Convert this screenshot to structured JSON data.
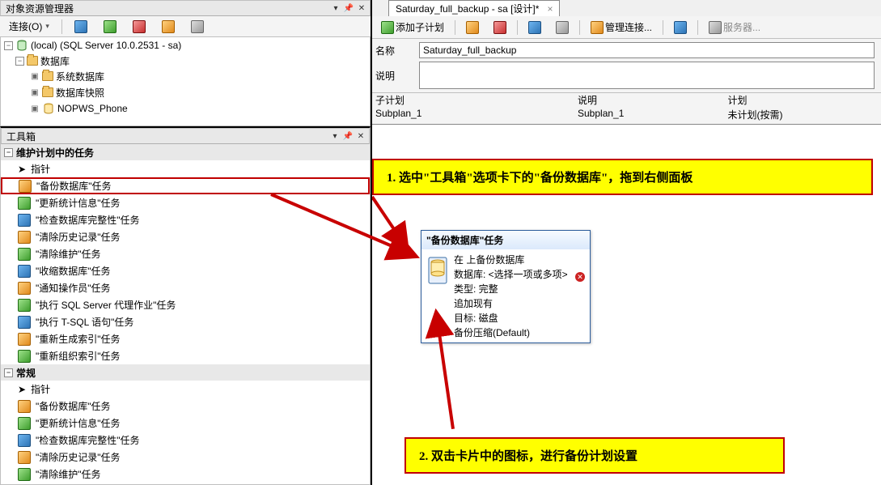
{
  "object_explorer": {
    "title": "对象资源管理器",
    "connect_label": "连接(O)",
    "root": "(local) (SQL Server 10.0.2531 - sa)",
    "db_node": "数据库",
    "children": [
      "系统数据库",
      "数据库快照",
      "NOPWS_Phone"
    ]
  },
  "toolbox": {
    "title": "工具箱",
    "category1": "维护计划中的任务",
    "category2": "常规",
    "pointer": "指针",
    "items1": [
      "\"备份数据库\"任务",
      "\"更新统计信息\"任务",
      "\"检查数据库完整性\"任务",
      "\"清除历史记录\"任务",
      "\"清除维护\"任务",
      "\"收缩数据库\"任务",
      "\"通知操作员\"任务",
      "\"执行 SQL Server 代理作业\"任务",
      "\"执行 T-SQL 语句\"任务",
      "\"重新生成索引\"任务",
      "\"重新组织索引\"任务"
    ],
    "items2": [
      "指针",
      "\"备份数据库\"任务",
      "\"更新统计信息\"任务",
      "\"检查数据库完整性\"任务",
      "\"清除历史记录\"任务",
      "\"清除维护\"任务"
    ]
  },
  "document": {
    "tab_title": "Saturday_full_backup - sa [设计]*",
    "toolbar": {
      "add_subplan": "添加子计划",
      "manage_conn": "管理连接...",
      "server": "服务器..."
    },
    "form": {
      "name_label": "名称",
      "name_value": "Saturday_full_backup",
      "desc_label": "说明"
    },
    "grid": {
      "head_subplan": "子计划",
      "head_desc": "说明",
      "head_plan": "计划",
      "row_subplan": "Subplan_1",
      "row_desc": "Subplan_1",
      "row_plan": "未计划(按需)"
    },
    "task_card": {
      "title": "\"备份数据库\"任务",
      "line1": "在 上备份数据库",
      "line2": "数据库: <选择一项或多项>",
      "line3": "类型: 完整",
      "line4": "追加现有",
      "line5": "目标: 磁盘",
      "line6": "备份压缩(Default)"
    }
  },
  "callouts": {
    "c1": "1.   选中\"工具箱\"选项卡下的\"备份数据库\"，拖到右侧面板",
    "c2": "2.   双击卡片中的图标，进行备份计划设置"
  }
}
